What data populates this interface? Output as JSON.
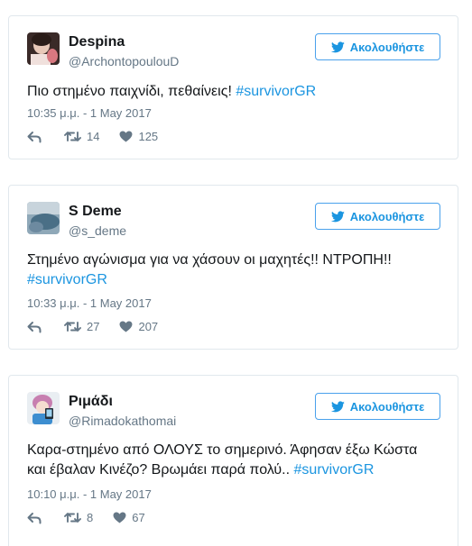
{
  "colors": {
    "accent": "#1b95e0",
    "text_primary": "#14171a",
    "text_secondary": "#657786",
    "border": "#e1e8ed"
  },
  "tweets": [
    {
      "author_name": "Despina",
      "author_handle": "@ArchontopoulouD",
      "avatar_icon": "user-avatar-photo",
      "follow_label": "Ακολουθήστε",
      "text": "Πιο στημένο παιχνίδι, πεθαίνεις! ",
      "hashtag": "#survivorGR",
      "timestamp": "10:35 μ.μ. - 1 May 2017",
      "retweets": "14",
      "likes": "125"
    },
    {
      "author_name": "S Deme",
      "author_handle": "@s_deme",
      "avatar_icon": "user-avatar-photo",
      "follow_label": "Ακολουθήστε",
      "text": "Στημένο αγώνισμα για να χάσουν οι μαχητές!! ΝΤΡΟΠΗ!! ",
      "hashtag": "#survivorGR",
      "timestamp": "10:33 μ.μ. - 1 May 2017",
      "retweets": "27",
      "likes": "207"
    },
    {
      "author_name": "Ριμάδι",
      "author_handle": "@Rimadokathomai",
      "avatar_icon": "user-avatar-cartoon",
      "follow_label": "Ακολουθήστε",
      "text": "Καρα-στημένο από ΟΛΟΥΣ το σημερινό. Άφησαν έξω Κώστα και έβαλαν Κινέζο? Βρωμάει παρά πολύ.. ",
      "hashtag": "#survivorGR",
      "timestamp": "10:10 μ.μ. - 1 May 2017",
      "retweets": "8",
      "likes": "67"
    }
  ]
}
